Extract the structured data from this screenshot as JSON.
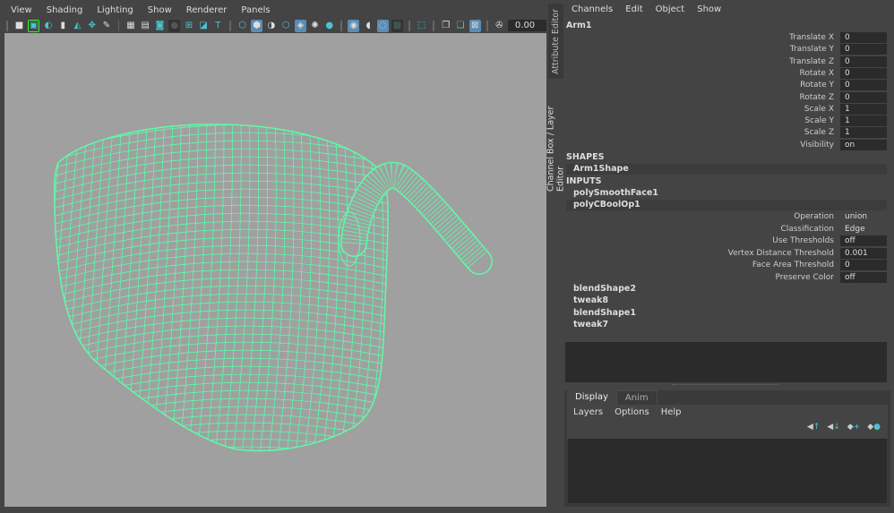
{
  "viewport_menu": [
    "View",
    "Shading",
    "Lighting",
    "Show",
    "Renderer",
    "Panels"
  ],
  "toolbar": {
    "icons": [
      "camera-icon",
      "lock-camera-icon",
      "camera-attributes-icon",
      "bookmark-icon",
      "image-plane-icon",
      "2d-pan-zoom-icon",
      "grease-pencil-icon",
      "grid-icon",
      "film-gate-icon",
      "resolution-gate-icon",
      "gate-mask-icon",
      "field-chart-icon",
      "safe-action-icon",
      "safe-title-icon",
      "wireframe-icon",
      "smooth-shade-icon",
      "shade-options-icon",
      "wireframe-on-shaded-icon",
      "textured-icon",
      "use-lights-icon",
      "shadows-icon",
      "screen-space-ambient-occlusion-icon",
      "motion-blur-icon",
      "anti-aliasing-icon",
      "depth-of-field-icon",
      "isolate-select-icon",
      "xray-icon",
      "xray-joints-icon",
      "xray-active-icon",
      "exposure-icon"
    ],
    "time_value": "0.00"
  },
  "side_tabs": [
    "Attribute Editor",
    "Channel Box / Layer Editor"
  ],
  "channel_box": {
    "menu": [
      "Channels",
      "Edit",
      "Object",
      "Show"
    ],
    "object": "Arm1",
    "channels": [
      {
        "label": "Translate X",
        "value": "0"
      },
      {
        "label": "Translate Y",
        "value": "0"
      },
      {
        "label": "Translate Z",
        "value": "0"
      },
      {
        "label": "Rotate X",
        "value": "0"
      },
      {
        "label": "Rotate Y",
        "value": "0"
      },
      {
        "label": "Rotate Z",
        "value": "0"
      },
      {
        "label": "Scale X",
        "value": "1"
      },
      {
        "label": "Scale Y",
        "value": "1"
      },
      {
        "label": "Scale Z",
        "value": "1"
      },
      {
        "label": "Visibility",
        "value": "on"
      }
    ],
    "shapes_header": "SHAPES",
    "shape": "Arm1Shape",
    "inputs_header": "INPUTS",
    "inputs": [
      "polySmoothFace1",
      "polyCBoolOp1"
    ],
    "bool_attrs": [
      {
        "label": "Operation",
        "value": "union",
        "field": false
      },
      {
        "label": "Classification",
        "value": "Edge",
        "field": false
      },
      {
        "label": "Use Thresholds",
        "value": "off",
        "field": true
      },
      {
        "label": "Vertex Distance Threshold",
        "value": "0.001",
        "field": true
      },
      {
        "label": "Face Area Threshold",
        "value": "0",
        "field": true
      },
      {
        "label": "Preserve Color",
        "value": "off",
        "field": true
      }
    ],
    "more_inputs": [
      "blendShape2",
      "tweak8",
      "blendShape1",
      "tweak7"
    ]
  },
  "layer_editor": {
    "tabs": [
      "Display",
      "Anim"
    ],
    "active_tab": "Display",
    "menu": [
      "Layers",
      "Options",
      "Help"
    ],
    "icons": [
      "move-layer-up-icon",
      "move-layer-down-icon",
      "new-layer-icon",
      "new-layer-from-selected-icon"
    ]
  },
  "colors": {
    "wireframe": "#5dfca8",
    "accent": "#5a8db5",
    "viewport_bg": "#a0a0a0"
  }
}
